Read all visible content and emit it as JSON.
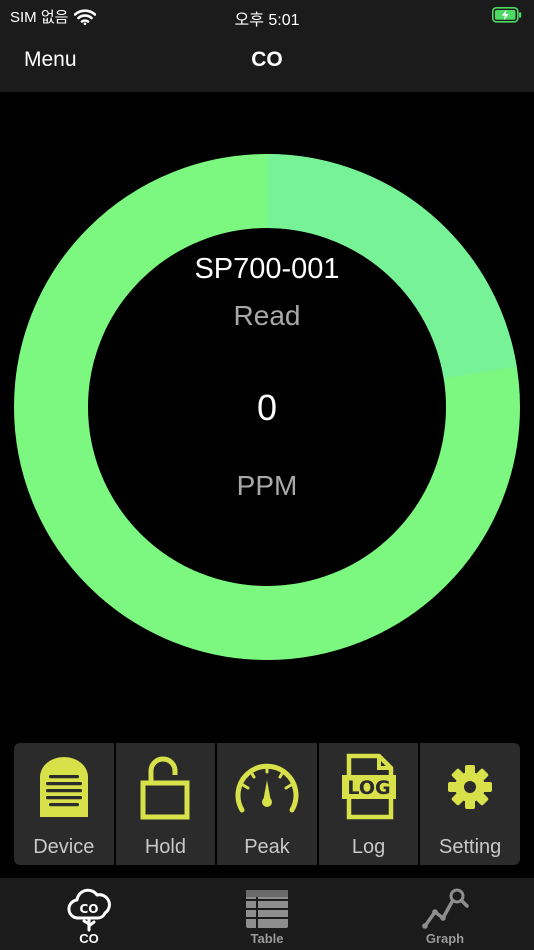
{
  "status_bar": {
    "carrier": "SIM 없음",
    "time": "오후 5:01"
  },
  "nav": {
    "menu_label": "Menu",
    "title": "CO"
  },
  "gauge": {
    "device_name": "SP700-001",
    "mode": "Read",
    "value": "0",
    "unit": "PPM",
    "ring_colors": [
      "#78f297",
      "#7cf77f"
    ]
  },
  "toolbar": {
    "accent": "#d8e04a",
    "items": [
      {
        "label": "Device",
        "icon": "device-icon"
      },
      {
        "label": "Hold",
        "icon": "unlock-icon"
      },
      {
        "label": "Peak",
        "icon": "gauge-icon"
      },
      {
        "label": "Log",
        "icon": "log-icon"
      },
      {
        "label": "Setting",
        "icon": "gear-icon"
      }
    ]
  },
  "tabbar": {
    "items": [
      {
        "label": "CO",
        "icon": "co-cloud-icon",
        "active": true
      },
      {
        "label": "Table",
        "icon": "table-icon",
        "active": false
      },
      {
        "label": "Graph",
        "icon": "graph-icon",
        "active": false
      }
    ]
  }
}
